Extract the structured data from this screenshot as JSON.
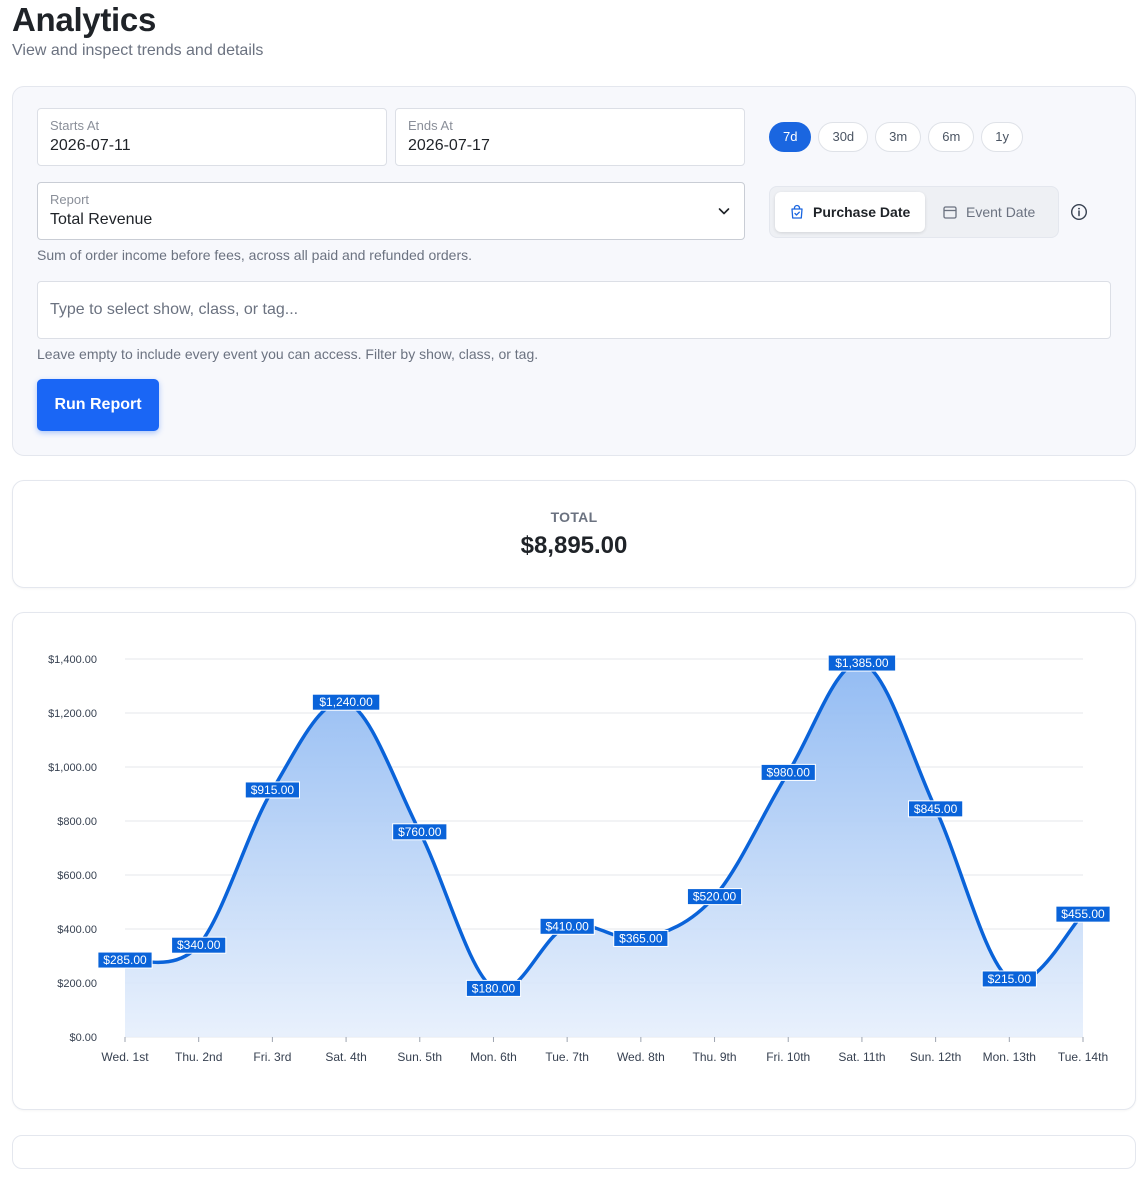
{
  "header": {
    "title": "Analytics",
    "subtitle": "View and inspect trends and details"
  },
  "filters": {
    "starts_at": {
      "label": "Starts At",
      "value": "2026-07-11"
    },
    "ends_at": {
      "label": "Ends At",
      "value": "2026-07-17"
    },
    "ranges": [
      {
        "label": "7d",
        "active": true
      },
      {
        "label": "30d",
        "active": false
      },
      {
        "label": "3m",
        "active": false
      },
      {
        "label": "6m",
        "active": false
      },
      {
        "label": "1y",
        "active": false
      }
    ],
    "date_type": {
      "purchase_label": "Purchase Date",
      "event_label": "Event Date",
      "selected": "Purchase Date"
    },
    "report": {
      "label": "Report",
      "value": "Total Revenue",
      "help": "Sum of order income before fees, across all paid and refunded orders."
    },
    "event_filter": {
      "placeholder": "Type to select show, class, or tag...",
      "help": "Leave empty to include every event you can access. Filter by show, class, or tag."
    },
    "run_label": "Run Report"
  },
  "total": {
    "label": "TOTAL",
    "value": "$8,895.00"
  },
  "colors": {
    "accent": "#1a66e0",
    "line": "#0a63d9",
    "area_top": "#8db8f2",
    "area_bottom": "#e6effc"
  },
  "chart_data": {
    "type": "area",
    "categories": [
      "Wed. 1st",
      "Thu. 2nd",
      "Fri. 3rd",
      "Sat. 4th",
      "Sun. 5th",
      "Mon. 6th",
      "Tue. 7th",
      "Wed. 8th",
      "Thu. 9th",
      "Fri. 10th",
      "Sat. 11th",
      "Sun. 12th",
      "Mon. 13th",
      "Tue. 14th"
    ],
    "values": [
      285,
      340,
      915,
      1240,
      760,
      180,
      410,
      365,
      520,
      980,
      1385,
      845,
      215,
      455
    ],
    "data_labels": [
      "$285.00",
      "$340.00",
      "$915.00",
      "$1,240.00",
      "$760.00",
      "$180.00",
      "$410.00",
      "$365.00",
      "$520.00",
      "$980.00",
      "$1,385.00",
      "$845.00",
      "$215.00",
      "$455.00"
    ],
    "y_ticks": [
      0,
      200,
      400,
      600,
      800,
      1000,
      1200,
      1400
    ],
    "y_tick_labels": [
      "$0.00",
      "$200.00",
      "$400.00",
      "$600.00",
      "$800.00",
      "$1,000.00",
      "$1,200.00",
      "$1,400.00"
    ],
    "ylim": [
      0,
      1400
    ],
    "grid": true,
    "title": "",
    "xlabel": "",
    "ylabel": ""
  }
}
